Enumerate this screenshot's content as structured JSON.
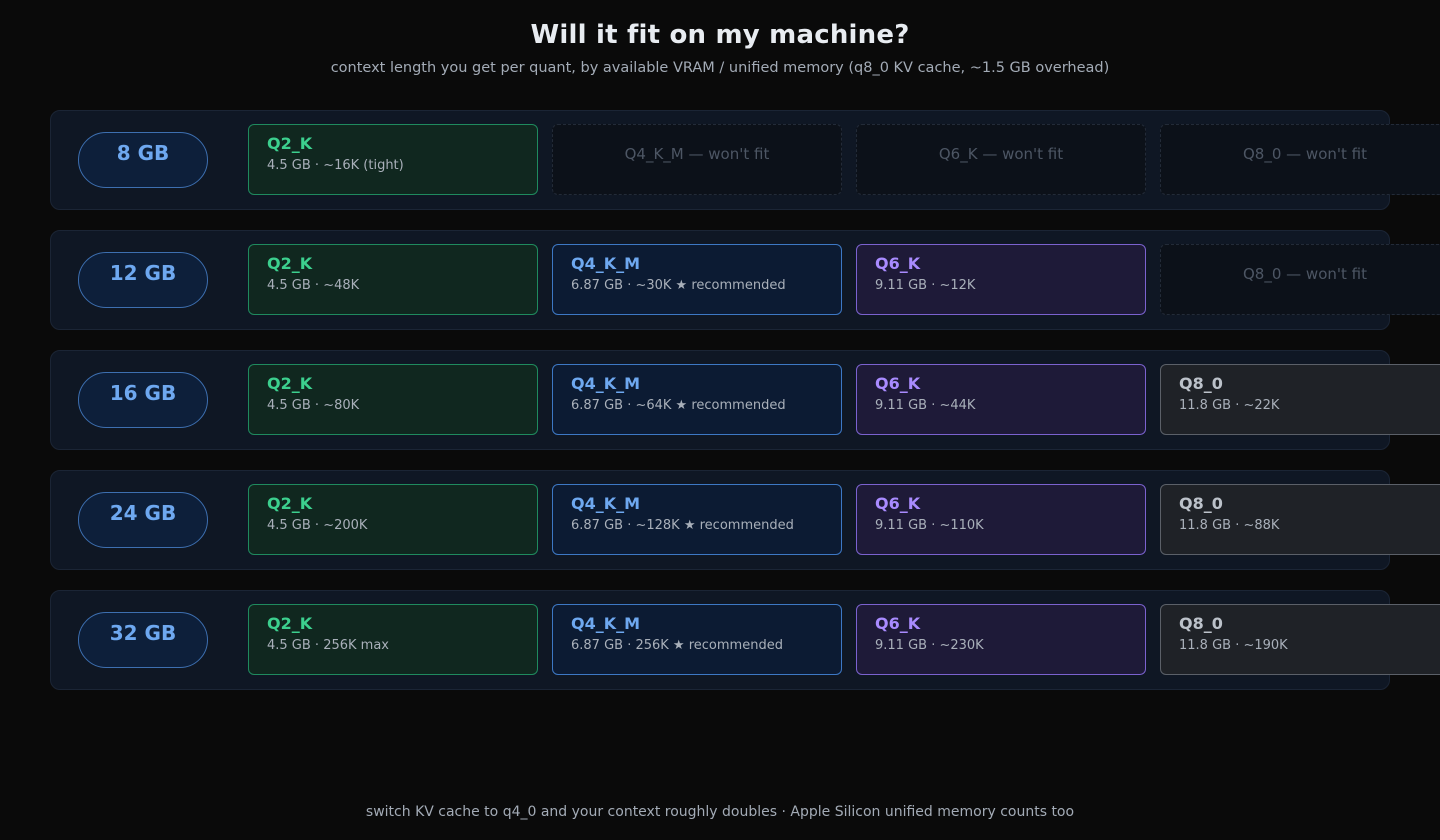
{
  "header": {
    "title": "Will it fit on my machine?",
    "subtitle": "context length you get per quant, by available VRAM / unified memory (q8_0 KV cache, ~1.5 GB overhead)"
  },
  "rows": [
    {
      "memory": "8 GB",
      "cells": [
        {
          "fits": true,
          "tone": "green",
          "quant": "Q2_K",
          "detail": "4.5 GB · ~16K (tight)"
        },
        {
          "fits": false,
          "label": "Q4_K_M — won't fit"
        },
        {
          "fits": false,
          "label": "Q6_K — won't fit"
        },
        {
          "fits": false,
          "label": "Q8_0 — won't fit"
        }
      ]
    },
    {
      "memory": "12 GB",
      "cells": [
        {
          "fits": true,
          "tone": "green",
          "quant": "Q2_K",
          "detail": "4.5 GB · ~48K"
        },
        {
          "fits": true,
          "tone": "blue",
          "quant": "Q4_K_M",
          "detail": "6.87 GB · ~30K ★ recommended"
        },
        {
          "fits": true,
          "tone": "purple",
          "quant": "Q6_K",
          "detail": "9.11 GB · ~12K"
        },
        {
          "fits": false,
          "label": "Q8_0 — won't fit"
        }
      ]
    },
    {
      "memory": "16 GB",
      "cells": [
        {
          "fits": true,
          "tone": "green",
          "quant": "Q2_K",
          "detail": "4.5 GB · ~80K"
        },
        {
          "fits": true,
          "tone": "blue",
          "quant": "Q4_K_M",
          "detail": "6.87 GB · ~64K ★ recommended"
        },
        {
          "fits": true,
          "tone": "purple",
          "quant": "Q6_K",
          "detail": "9.11 GB · ~44K"
        },
        {
          "fits": true,
          "tone": "gray",
          "quant": "Q8_0",
          "detail": "11.8 GB · ~22K"
        }
      ]
    },
    {
      "memory": "24 GB",
      "cells": [
        {
          "fits": true,
          "tone": "green",
          "quant": "Q2_K",
          "detail": "4.5 GB · ~200K"
        },
        {
          "fits": true,
          "tone": "blue",
          "quant": "Q4_K_M",
          "detail": "6.87 GB · ~128K ★ recommended"
        },
        {
          "fits": true,
          "tone": "purple",
          "quant": "Q6_K",
          "detail": "9.11 GB · ~110K"
        },
        {
          "fits": true,
          "tone": "gray",
          "quant": "Q8_0",
          "detail": "11.8 GB · ~88K"
        }
      ]
    },
    {
      "memory": "32 GB",
      "cells": [
        {
          "fits": true,
          "tone": "green",
          "quant": "Q2_K",
          "detail": "4.5 GB · 256K max"
        },
        {
          "fits": true,
          "tone": "blue",
          "quant": "Q4_K_M",
          "detail": "6.87 GB · 256K ★ recommended"
        },
        {
          "fits": true,
          "tone": "purple",
          "quant": "Q6_K",
          "detail": "9.11 GB · ~230K"
        },
        {
          "fits": true,
          "tone": "gray",
          "quant": "Q8_0",
          "detail": "11.8 GB · ~190K"
        }
      ]
    }
  ],
  "footer": {
    "note": "switch KV cache to q4_0 and your context roughly doubles · Apple Silicon unified memory counts too"
  },
  "colors": {
    "background": "#0a0a0a",
    "green": "#3ccf8e",
    "blue": "#6ea8f0",
    "purple": "#a98bff",
    "gray": "#bcc2ca"
  }
}
